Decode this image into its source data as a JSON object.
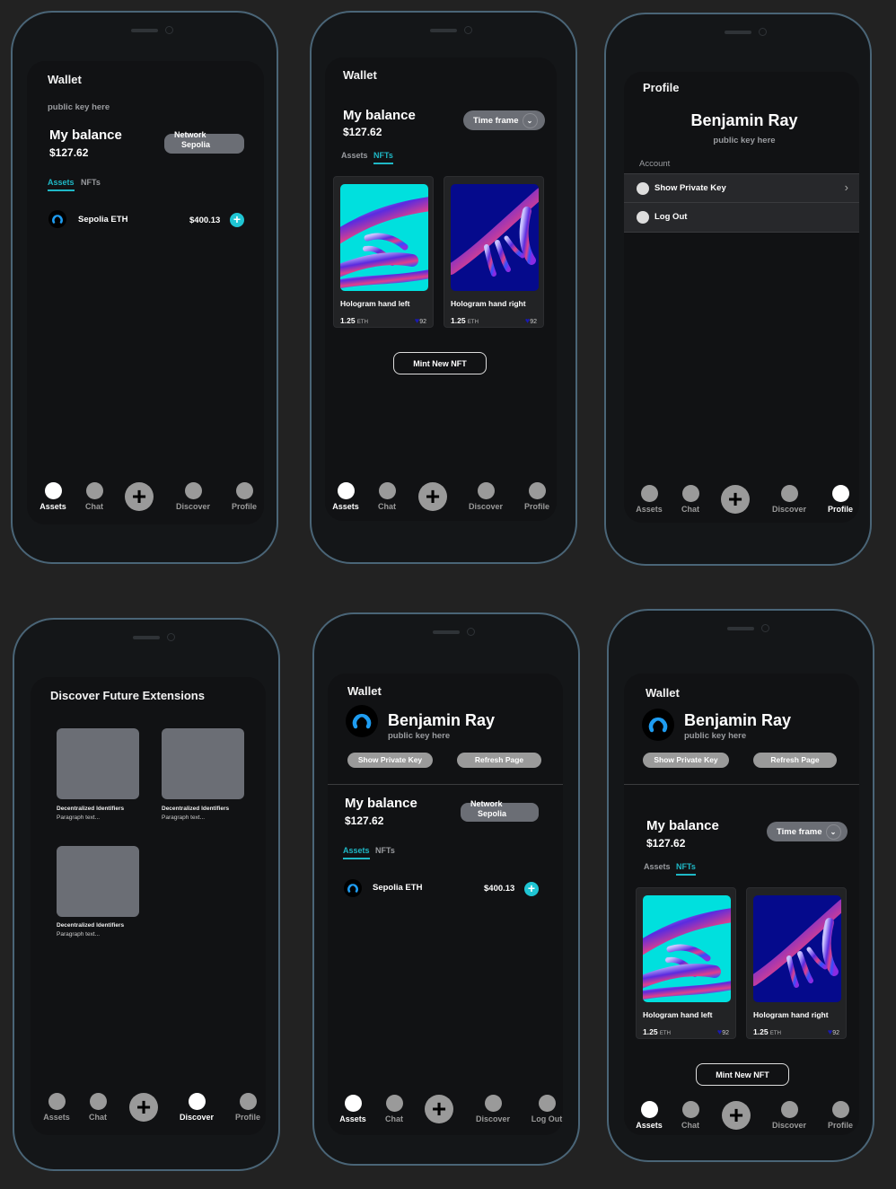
{
  "colors": {
    "accent": "#1fb8c6",
    "background": "#222222",
    "phone_frame": "#4a6577",
    "pill": "#6b6e75"
  },
  "icons": {
    "coin": "sepolia-eth-icon",
    "plus": "plus-icon",
    "avatar": "user-avatar-icon",
    "chevron": "chevron-down-icon",
    "arrow": "chevron-right-icon",
    "heart": "heart-icon"
  },
  "phones": [
    {
      "title": "Wallet",
      "public_key": "public key here",
      "balance_label": "My balance",
      "balance": "$127.62",
      "network_label": "Network",
      "network_value": "Sepolia",
      "tabs": [
        "Assets",
        "NFTs"
      ],
      "active_tab": "Assets",
      "asset": {
        "name": "Sepolia ETH",
        "value": "$400.13"
      },
      "nav": [
        "Assets",
        "Chat",
        "Discover",
        "Profile"
      ],
      "active_nav": "Assets"
    },
    {
      "title": "Wallet",
      "balance_label": "My balance",
      "balance": "$127.62",
      "timeframe": "Time frame",
      "tabs": [
        "Assets",
        "NFTs"
      ],
      "active_tab": "NFTs",
      "nfts": [
        {
          "title": "Hologram hand left",
          "price": "1.25",
          "unit": "ETH",
          "likes": "92"
        },
        {
          "title": "Hologram hand right",
          "price": "1.25",
          "unit": "ETH",
          "likes": "92"
        }
      ],
      "mint_label": "Mint New NFT",
      "nav": [
        "Assets",
        "Chat",
        "Discover",
        "Profile"
      ],
      "active_nav": "Assets"
    },
    {
      "title": "Profile",
      "name": "Benjamin Ray",
      "public_key": "public key here",
      "section": "Account",
      "rows": [
        "Show Private Key",
        "Log Out"
      ],
      "nav": [
        "Assets",
        "Chat",
        "Discover",
        "Profile"
      ],
      "active_nav": "Profile"
    },
    {
      "title": "Discover Future Extensions",
      "tiles": [
        {
          "title": "Decentralized Identifiers",
          "text": "Paragraph text..."
        },
        {
          "title": "Decentralized Identifiers",
          "text": "Paragraph text..."
        },
        {
          "title": "Decentralized Identifiers",
          "text": "Paragraph text..."
        }
      ],
      "nav": [
        "Assets",
        "Chat",
        "Discover",
        "Profile"
      ],
      "active_nav": "Discover"
    },
    {
      "title": "Wallet",
      "name": "Benjamin Ray",
      "public_key": "public key here",
      "show_key": "Show Private Key",
      "refresh": "Refresh Page",
      "balance_label": "My balance",
      "balance": "$127.62",
      "network_label": "Network",
      "network_value": "Sepolia",
      "tabs": [
        "Assets",
        "NFTs"
      ],
      "active_tab": "Assets",
      "asset": {
        "name": "Sepolia ETH",
        "value": "$400.13"
      },
      "nav": [
        "Assets",
        "Chat",
        "Discover",
        "Log Out"
      ],
      "active_nav": "Assets"
    },
    {
      "title": "Wallet",
      "name": "Benjamin Ray",
      "public_key": "public key here",
      "show_key": "Show Private Key",
      "refresh": "Refresh Page",
      "balance_label": "My balance",
      "balance": "$127.62",
      "timeframe": "Time frame",
      "tabs": [
        "Assets",
        "NFTs"
      ],
      "active_tab": "NFTs",
      "nfts": [
        {
          "title": "Hologram hand left",
          "price": "1.25",
          "unit": "ETH",
          "likes": "92"
        },
        {
          "title": "Hologram hand right",
          "price": "1.25",
          "unit": "ETH",
          "likes": "92"
        }
      ],
      "mint_label": "Mint New NFT",
      "nav": [
        "Assets",
        "Chat",
        "Discover",
        "Profile"
      ],
      "active_nav": "Assets"
    }
  ]
}
